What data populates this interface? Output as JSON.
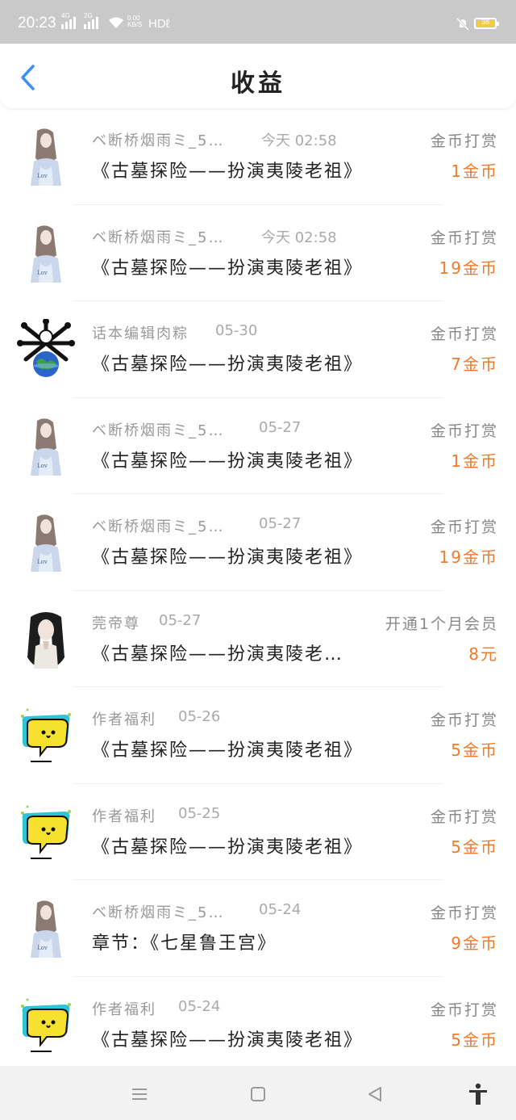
{
  "status_bar": {
    "time": "20:23",
    "sim1": "4G",
    "sim2": "2G",
    "net_speed": "0.00 KB/S",
    "hd": "HDℓ",
    "battery": "38"
  },
  "header": {
    "title": "收益",
    "back_icon": "chevron-left-icon"
  },
  "colors": {
    "accent": "#3b8ff5",
    "amount": "#f07a2a",
    "muted": "#999999"
  },
  "items": [
    {
      "avatar": "portrait-girl",
      "name": "ベ断桥烟雨ミ_5…",
      "date": "今天 02:58",
      "type": "金币打赏",
      "book": "《古墓探险——扮演夷陵老祖》",
      "amount": "1金币"
    },
    {
      "avatar": "portrait-girl",
      "name": "ベ断桥烟雨ミ_5…",
      "date": "今天 02:58",
      "type": "金币打赏",
      "book": "《古墓探险——扮演夷陵老祖》",
      "amount": "19金币"
    },
    {
      "avatar": "earth-bones",
      "name": "话本编辑肉粽",
      "date": "05-30",
      "type": "金币打赏",
      "book": "《古墓探险——扮演夷陵老祖》",
      "amount": "7金币"
    },
    {
      "avatar": "portrait-girl",
      "name": "ベ断桥烟雨ミ_5…",
      "date": "05-27",
      "type": "金币打赏",
      "book": "《古墓探险——扮演夷陵老祖》",
      "amount": "1金币"
    },
    {
      "avatar": "portrait-girl",
      "name": "ベ断桥烟雨ミ_5…",
      "date": "05-27",
      "type": "金币打赏",
      "book": "《古墓探险——扮演夷陵老祖》",
      "amount": "19金币"
    },
    {
      "avatar": "portrait-man",
      "name": "莞帝尊",
      "date": "05-27",
      "type": "开通1个月会员",
      "book": "《古墓探险——扮演夷陵老…",
      "amount": "8元"
    },
    {
      "avatar": "chat-bubble",
      "name": "作者福利",
      "date": "05-26",
      "type": "金币打赏",
      "book": "《古墓探险——扮演夷陵老祖》",
      "amount": "5金币"
    },
    {
      "avatar": "chat-bubble",
      "name": "作者福利",
      "date": "05-25",
      "type": "金币打赏",
      "book": "《古墓探险——扮演夷陵老祖》",
      "amount": "5金币"
    },
    {
      "avatar": "portrait-girl",
      "name": "ベ断桥烟雨ミ_5…",
      "date": "05-24",
      "type": "金币打赏",
      "book": "章节：《七星鲁王宫》",
      "amount": "9金币"
    },
    {
      "avatar": "chat-bubble",
      "name": "作者福利",
      "date": "05-24",
      "type": "金币打赏",
      "book": "《古墓探险——扮演夷陵老祖》",
      "amount": "5金币"
    }
  ],
  "system_nav": {
    "menu_icon": "menu-icon",
    "home_icon": "home-square-icon",
    "back_icon": "back-triangle-icon",
    "accessibility_icon": "accessibility-icon"
  }
}
